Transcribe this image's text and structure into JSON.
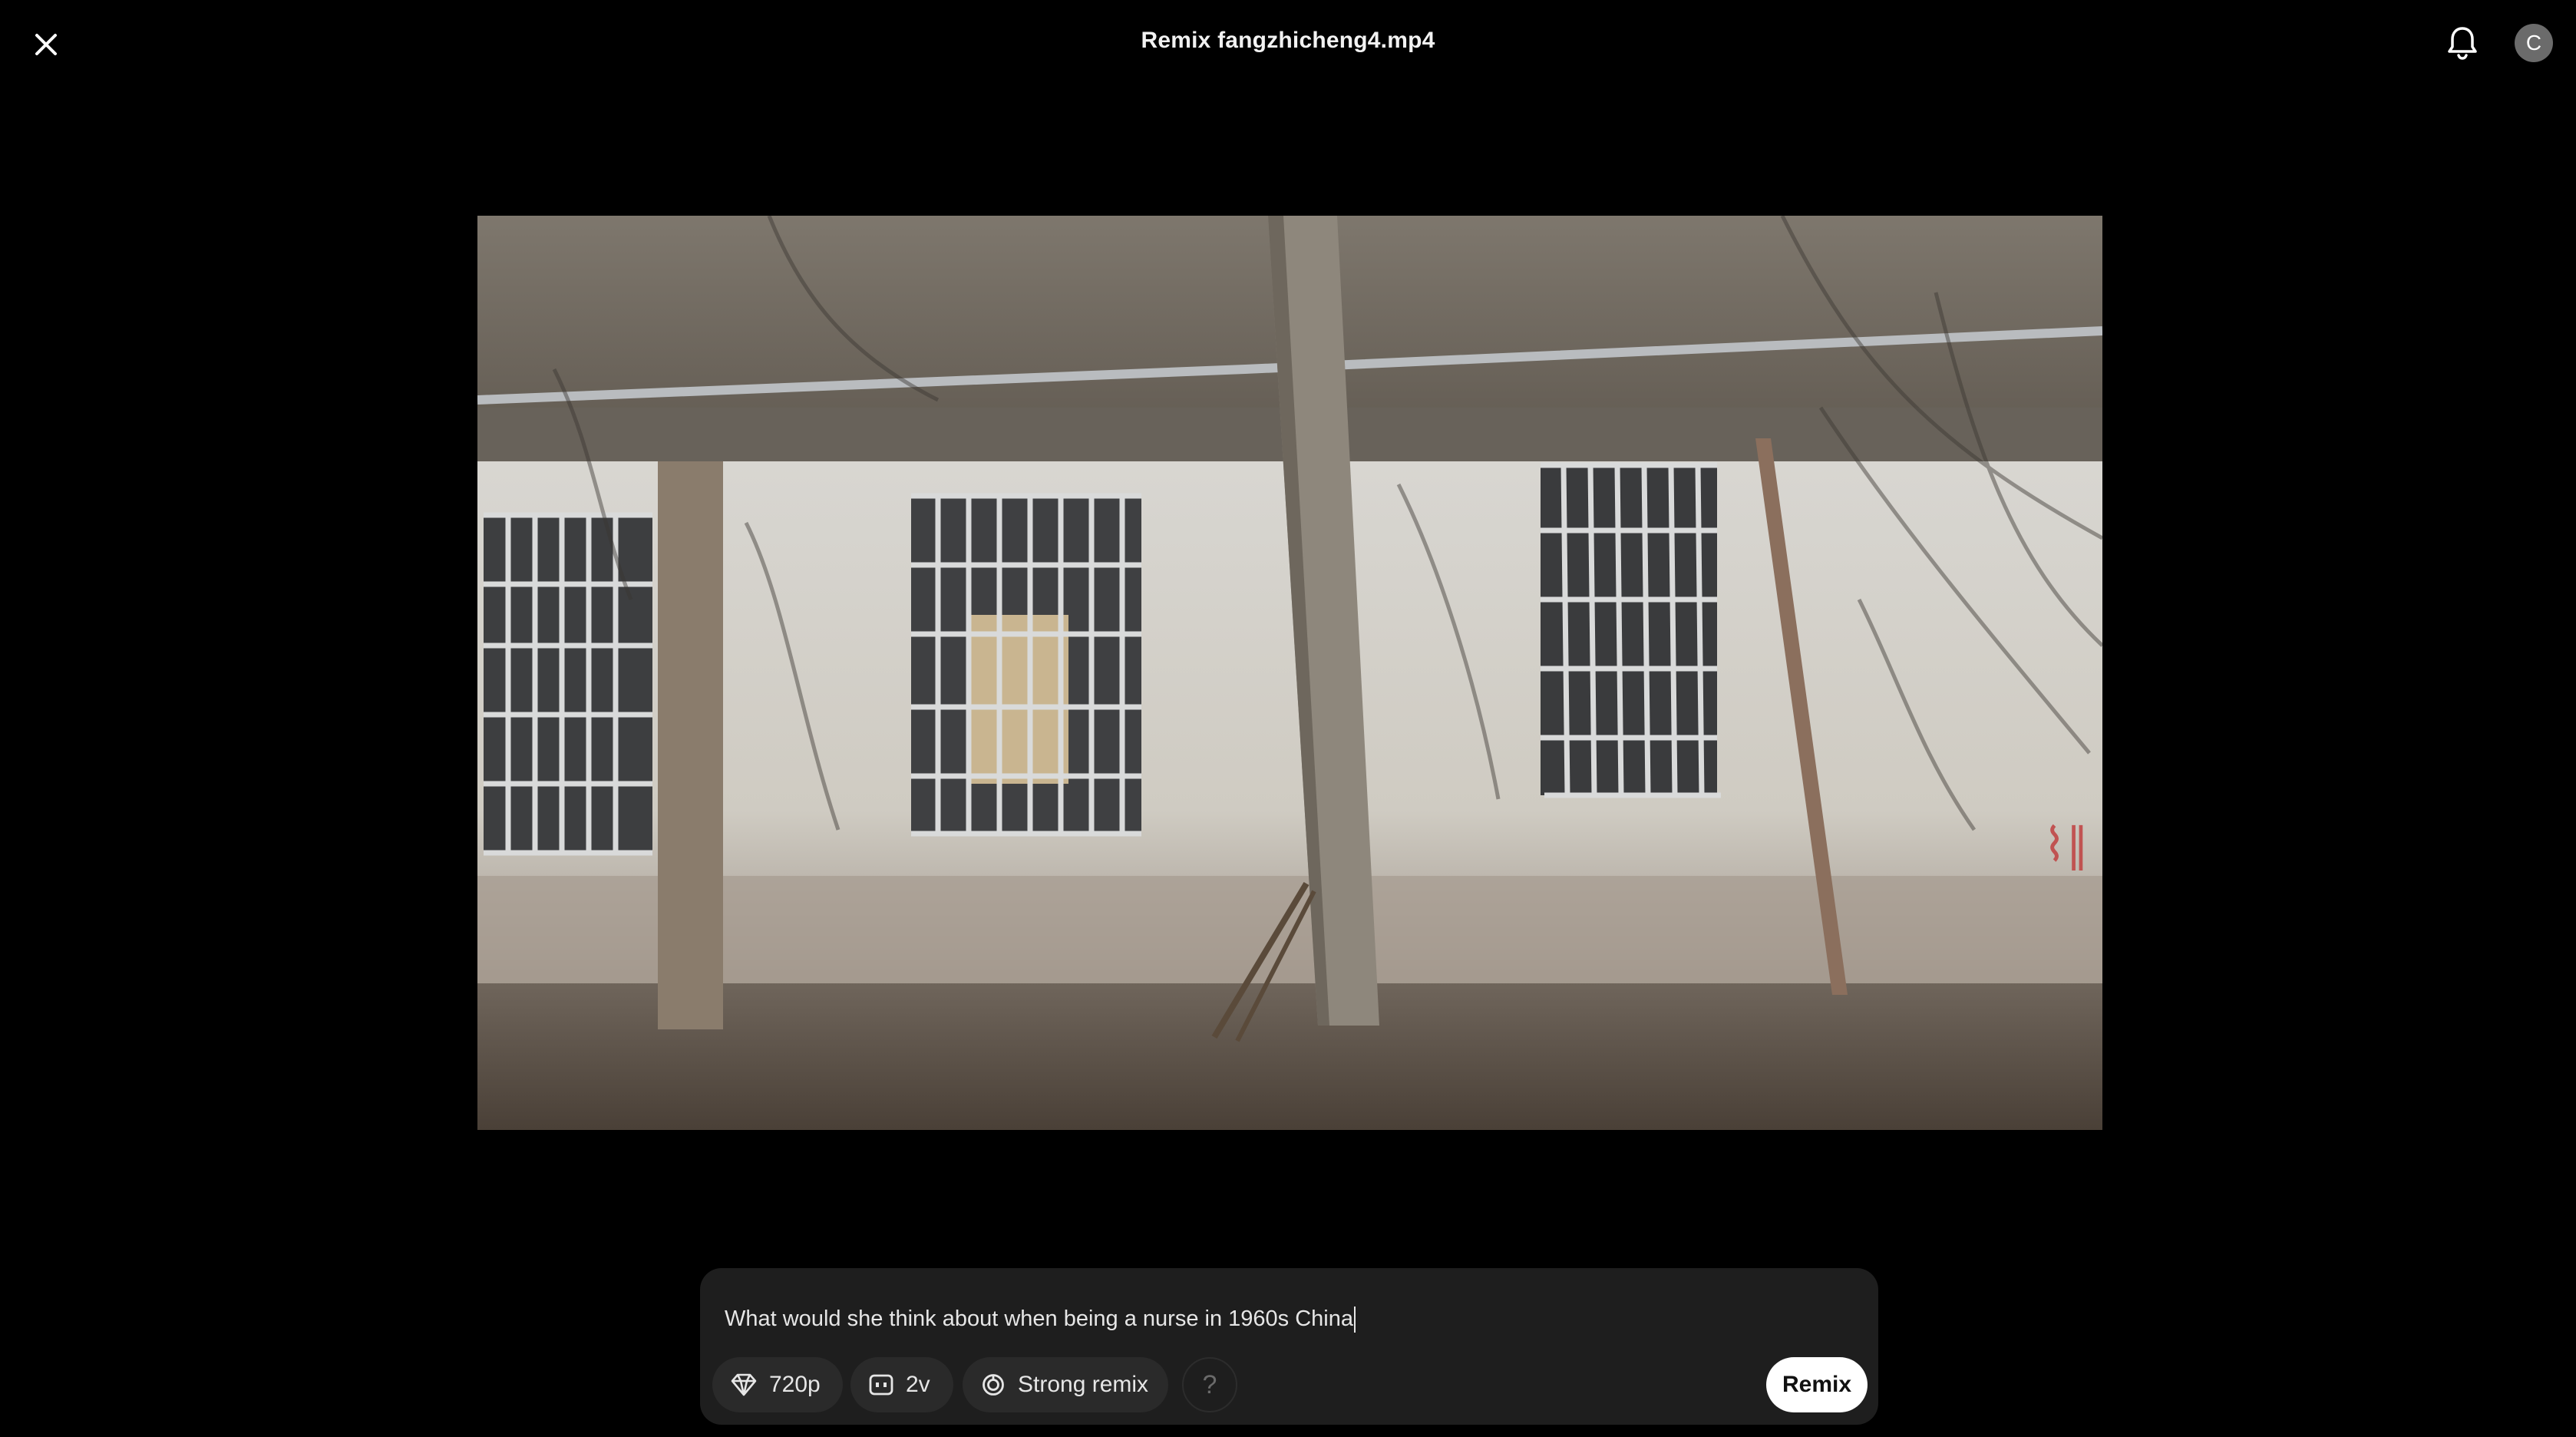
{
  "header": {
    "title": "Remix fangzhicheng4.mp4",
    "avatar_initial": "C",
    "close_icon": "close-icon",
    "notification_icon": "bell-icon"
  },
  "video": {
    "description_icon": "video-frame"
  },
  "composer": {
    "prompt_text": "What would she think about when being a nurse in 1960s China",
    "options": {
      "quality_label": "720p",
      "variations_label": "2v",
      "strength_label": "Strong remix",
      "help_label": "?"
    },
    "submit_label": "Remix"
  },
  "colors": {
    "background": "#000000",
    "composer_bg": "#1e1e1e",
    "chip_bg": "#2a2a2a",
    "submit_bg": "#ffffff"
  }
}
